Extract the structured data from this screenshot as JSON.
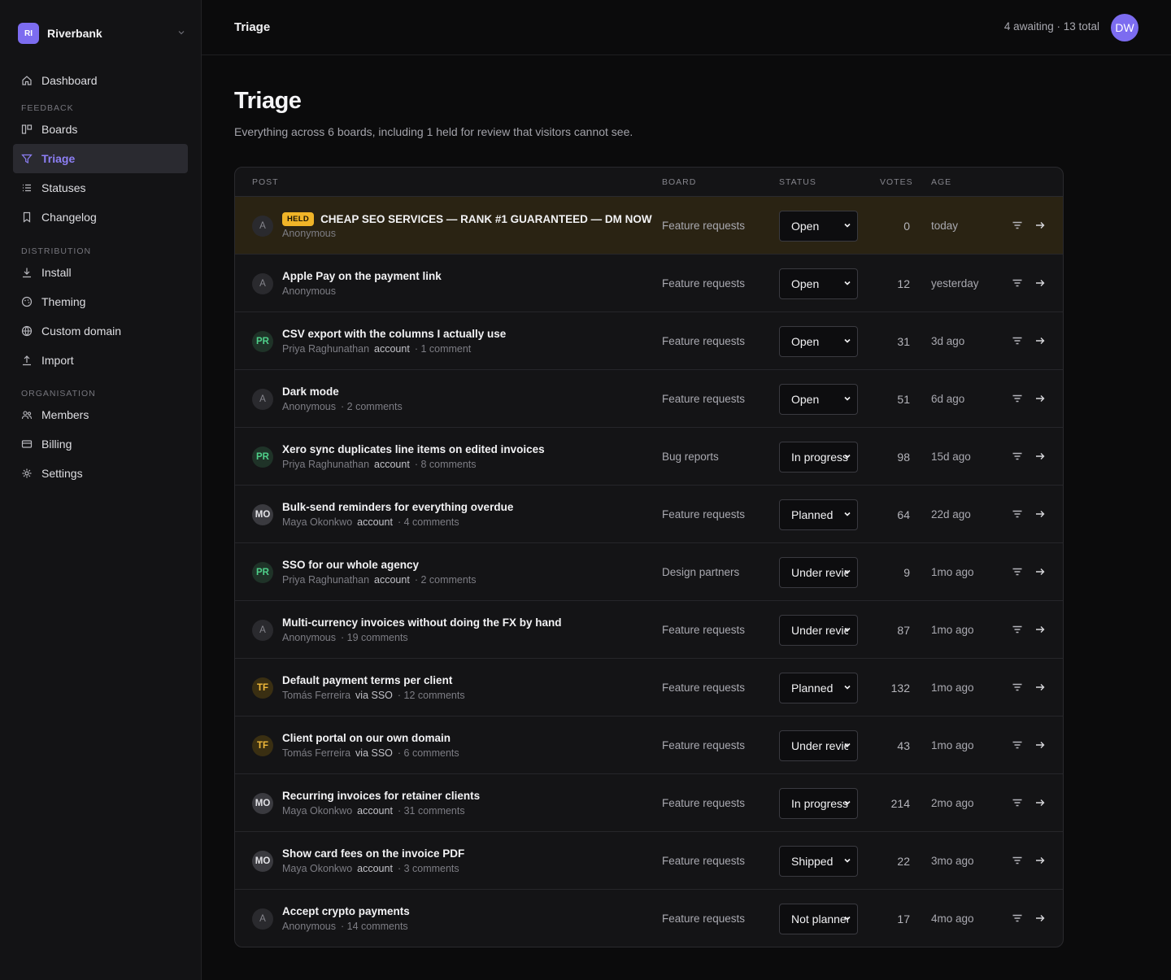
{
  "workspace": {
    "initials": "RI",
    "name": "Riverbank"
  },
  "nav": {
    "dashboard": "Dashboard",
    "feedback_section": "FEEDBACK",
    "boards": "Boards",
    "triage": "Triage",
    "statuses": "Statuses",
    "changelog": "Changelog",
    "distribution_section": "DISTRIBUTION",
    "install": "Install",
    "theming": "Theming",
    "custom_domain": "Custom domain",
    "import": "Import",
    "organisation_section": "ORGANISATION",
    "members": "Members",
    "billing": "Billing",
    "settings": "Settings"
  },
  "topbar": {
    "title": "Triage",
    "meta": "4 awaiting · 13 total",
    "user_initials": "DW"
  },
  "page": {
    "title": "Triage",
    "subtitle": "Everything across 6 boards, including 1 held for review that visitors cannot see."
  },
  "table": {
    "columns": {
      "post": "POST",
      "board": "BOARD",
      "status": "STATUS",
      "votes": "VOTES",
      "age": "AGE"
    },
    "rows": [
      {
        "held": true,
        "held_label": "HELD",
        "avatar": "A",
        "avatar_kind": "anon",
        "title": "CHEAP SEO SERVICES — RANK #1 GUARANTEED — DM NOW",
        "author": "Anonymous",
        "via": "",
        "comments": "",
        "board": "Feature requests",
        "status": "Open",
        "votes": "0",
        "age": "today"
      },
      {
        "held": false,
        "held_label": "",
        "avatar": "A",
        "avatar_kind": "anon",
        "title": "Apple Pay on the payment link",
        "author": "Anonymous",
        "via": "",
        "comments": "",
        "board": "Feature requests",
        "status": "Open",
        "votes": "12",
        "age": "yesterday"
      },
      {
        "held": false,
        "held_label": "",
        "avatar": "PR",
        "avatar_kind": "pr",
        "title": "CSV export with the columns I actually use",
        "author": "Priya Raghunathan",
        "via": "account",
        "comments": "· 1 comment",
        "board": "Feature requests",
        "status": "Open",
        "votes": "31",
        "age": "3d ago"
      },
      {
        "held": false,
        "held_label": "",
        "avatar": "A",
        "avatar_kind": "anon",
        "title": "Dark mode",
        "author": "Anonymous",
        "via": "",
        "comments": "· 2 comments",
        "board": "Feature requests",
        "status": "Open",
        "votes": "51",
        "age": "6d ago"
      },
      {
        "held": false,
        "held_label": "",
        "avatar": "PR",
        "avatar_kind": "pr",
        "title": "Xero sync duplicates line items on edited invoices",
        "author": "Priya Raghunathan",
        "via": "account",
        "comments": "· 8 comments",
        "board": "Bug reports",
        "status": "In progress",
        "votes": "98",
        "age": "15d ago"
      },
      {
        "held": false,
        "held_label": "",
        "avatar": "MO",
        "avatar_kind": "mo",
        "title": "Bulk-send reminders for everything overdue",
        "author": "Maya Okonkwo",
        "via": "account",
        "comments": "· 4 comments",
        "board": "Feature requests",
        "status": "Planned",
        "votes": "64",
        "age": "22d ago"
      },
      {
        "held": false,
        "held_label": "",
        "avatar": "PR",
        "avatar_kind": "pr",
        "title": "SSO for our whole agency",
        "author": "Priya Raghunathan",
        "via": "account",
        "comments": "· 2 comments",
        "board": "Design partners",
        "status": "Under review",
        "votes": "9",
        "age": "1mo ago"
      },
      {
        "held": false,
        "held_label": "",
        "avatar": "A",
        "avatar_kind": "anon",
        "title": "Multi-currency invoices without doing the FX by hand",
        "author": "Anonymous",
        "via": "",
        "comments": "· 19 comments",
        "board": "Feature requests",
        "status": "Under review",
        "votes": "87",
        "age": "1mo ago"
      },
      {
        "held": false,
        "held_label": "",
        "avatar": "TF",
        "avatar_kind": "tf",
        "title": "Default payment terms per client",
        "author": "Tomás Ferreira",
        "via": "via SSO",
        "comments": "· 12 comments",
        "board": "Feature requests",
        "status": "Planned",
        "votes": "132",
        "age": "1mo ago"
      },
      {
        "held": false,
        "held_label": "",
        "avatar": "TF",
        "avatar_kind": "tf",
        "title": "Client portal on our own domain",
        "author": "Tomás Ferreira",
        "via": "via SSO",
        "comments": "· 6 comments",
        "board": "Feature requests",
        "status": "Under review",
        "votes": "43",
        "age": "1mo ago"
      },
      {
        "held": false,
        "held_label": "",
        "avatar": "MO",
        "avatar_kind": "mo",
        "title": "Recurring invoices for retainer clients",
        "author": "Maya Okonkwo",
        "via": "account",
        "comments": "· 31 comments",
        "board": "Feature requests",
        "status": "In progress",
        "votes": "214",
        "age": "2mo ago"
      },
      {
        "held": false,
        "held_label": "",
        "avatar": "MO",
        "avatar_kind": "mo",
        "title": "Show card fees on the invoice PDF",
        "author": "Maya Okonkwo",
        "via": "account",
        "comments": "· 3 comments",
        "board": "Feature requests",
        "status": "Shipped",
        "votes": "22",
        "age": "3mo ago"
      },
      {
        "held": false,
        "held_label": "",
        "avatar": "A",
        "avatar_kind": "anon",
        "title": "Accept crypto payments",
        "author": "Anonymous",
        "via": "",
        "comments": "· 14 comments",
        "board": "Feature requests",
        "status": "Not planned",
        "votes": "17",
        "age": "4mo ago"
      }
    ]
  },
  "colors": {
    "accent": "#7c6cf0",
    "held_bg": "#2a2313",
    "held_badge": "#f0b428"
  },
  "icons": {
    "row_filter": "filter-lines-icon",
    "row_open": "arrow-right-icon"
  }
}
